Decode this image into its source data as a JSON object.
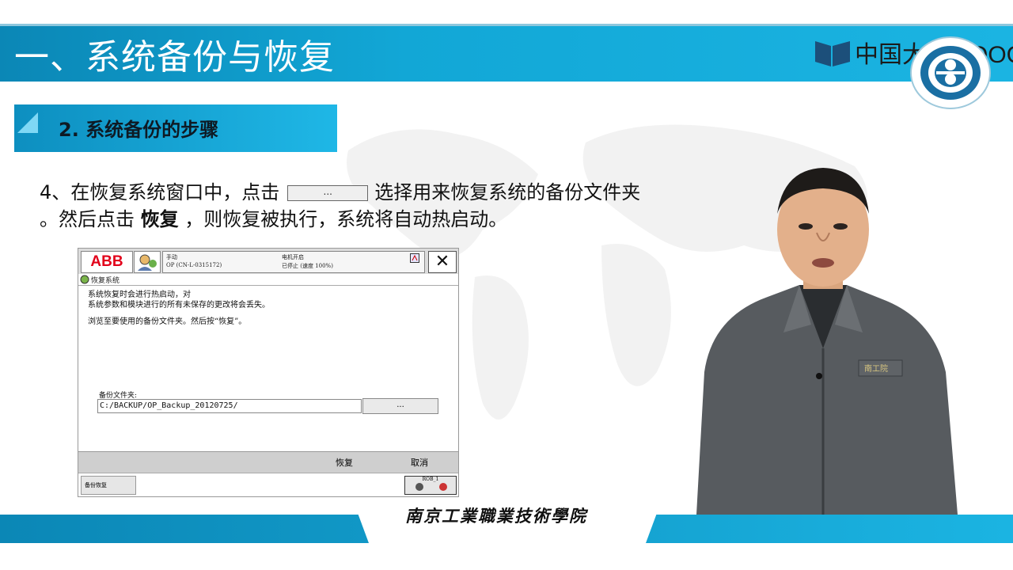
{
  "slide": {
    "title": "一、系统备份与恢复",
    "section_title": "2.  系统备份的步骤",
    "brand_text": "中国大学MOOC",
    "school_name": "南京工業職業技術學院"
  },
  "instruction": {
    "part1": "4、在恢复系统窗口中，点击",
    "button_label": "...",
    "part2": "选择用来恢复系统的备份文件夹",
    "part3": "。然后点击 ",
    "bold_word": "恢复",
    "part4": " ，则恢复被执行，系统将自动热启动。"
  },
  "abb_window": {
    "logo": "ABB",
    "status_mode": "手动",
    "status_controller": "OP (CN-L-0315172)",
    "status_motor": "电机开启",
    "status_speed": "已停止 (速度 100%)",
    "close_label": "✕",
    "header_title": "恢复系统",
    "body_line1": "系统恢复时会进行热启动，对",
    "body_line2": "系统参数和模块进行的所有未保存的更改将会丢失。",
    "body_line3": "浏览至要使用的备份文件夹。然后按“恢复”。",
    "folder_label": "备份文件夹:",
    "folder_value": "C:/BACKUP/OP_Backup_20120725/",
    "browse_label": "...",
    "restore_label": "恢复",
    "cancel_label": "取消",
    "task_label": "备份恢复",
    "rob_label": "ROB_1"
  },
  "presenter_badge": "南工院",
  "colors": {
    "bar_blue": "#12a7d6",
    "abb_red": "#e2001a"
  }
}
